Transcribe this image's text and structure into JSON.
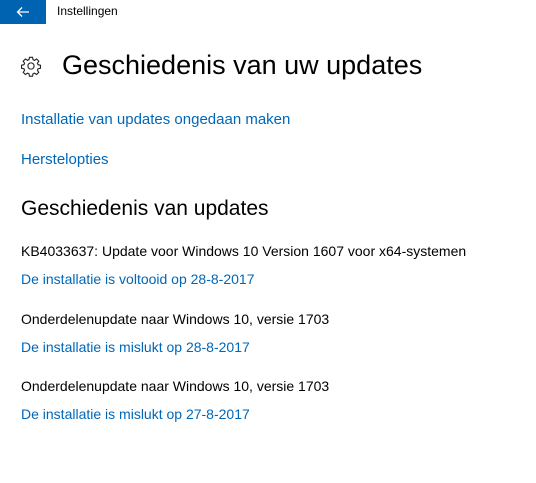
{
  "window": {
    "title": "Instellingen",
    "back_icon": "arrow-left-icon",
    "back_color": "#0063b1"
  },
  "page": {
    "icon": "gear-icon",
    "title": "Geschiedenis van uw updates"
  },
  "links": {
    "uninstall": "Installatie van updates ongedaan maken",
    "recovery": "Herstelopties"
  },
  "history": {
    "heading": "Geschiedenis van updates",
    "entries": [
      {
        "name": "KB4033637: Update voor Windows 10 Version 1607 voor x64-systemen",
        "status": "De installatie is voltooid op 28-8-2017"
      },
      {
        "name": "Onderdelenupdate naar Windows 10, versie 1703",
        "status": "De installatie is mislukt op 28-8-2017"
      },
      {
        "name": "Onderdelenupdate naar Windows 10, versie 1703",
        "status": "De installatie is mislukt op 27-8-2017"
      }
    ]
  },
  "colors": {
    "accent": "#0063b1",
    "link": "#0067b8"
  }
}
